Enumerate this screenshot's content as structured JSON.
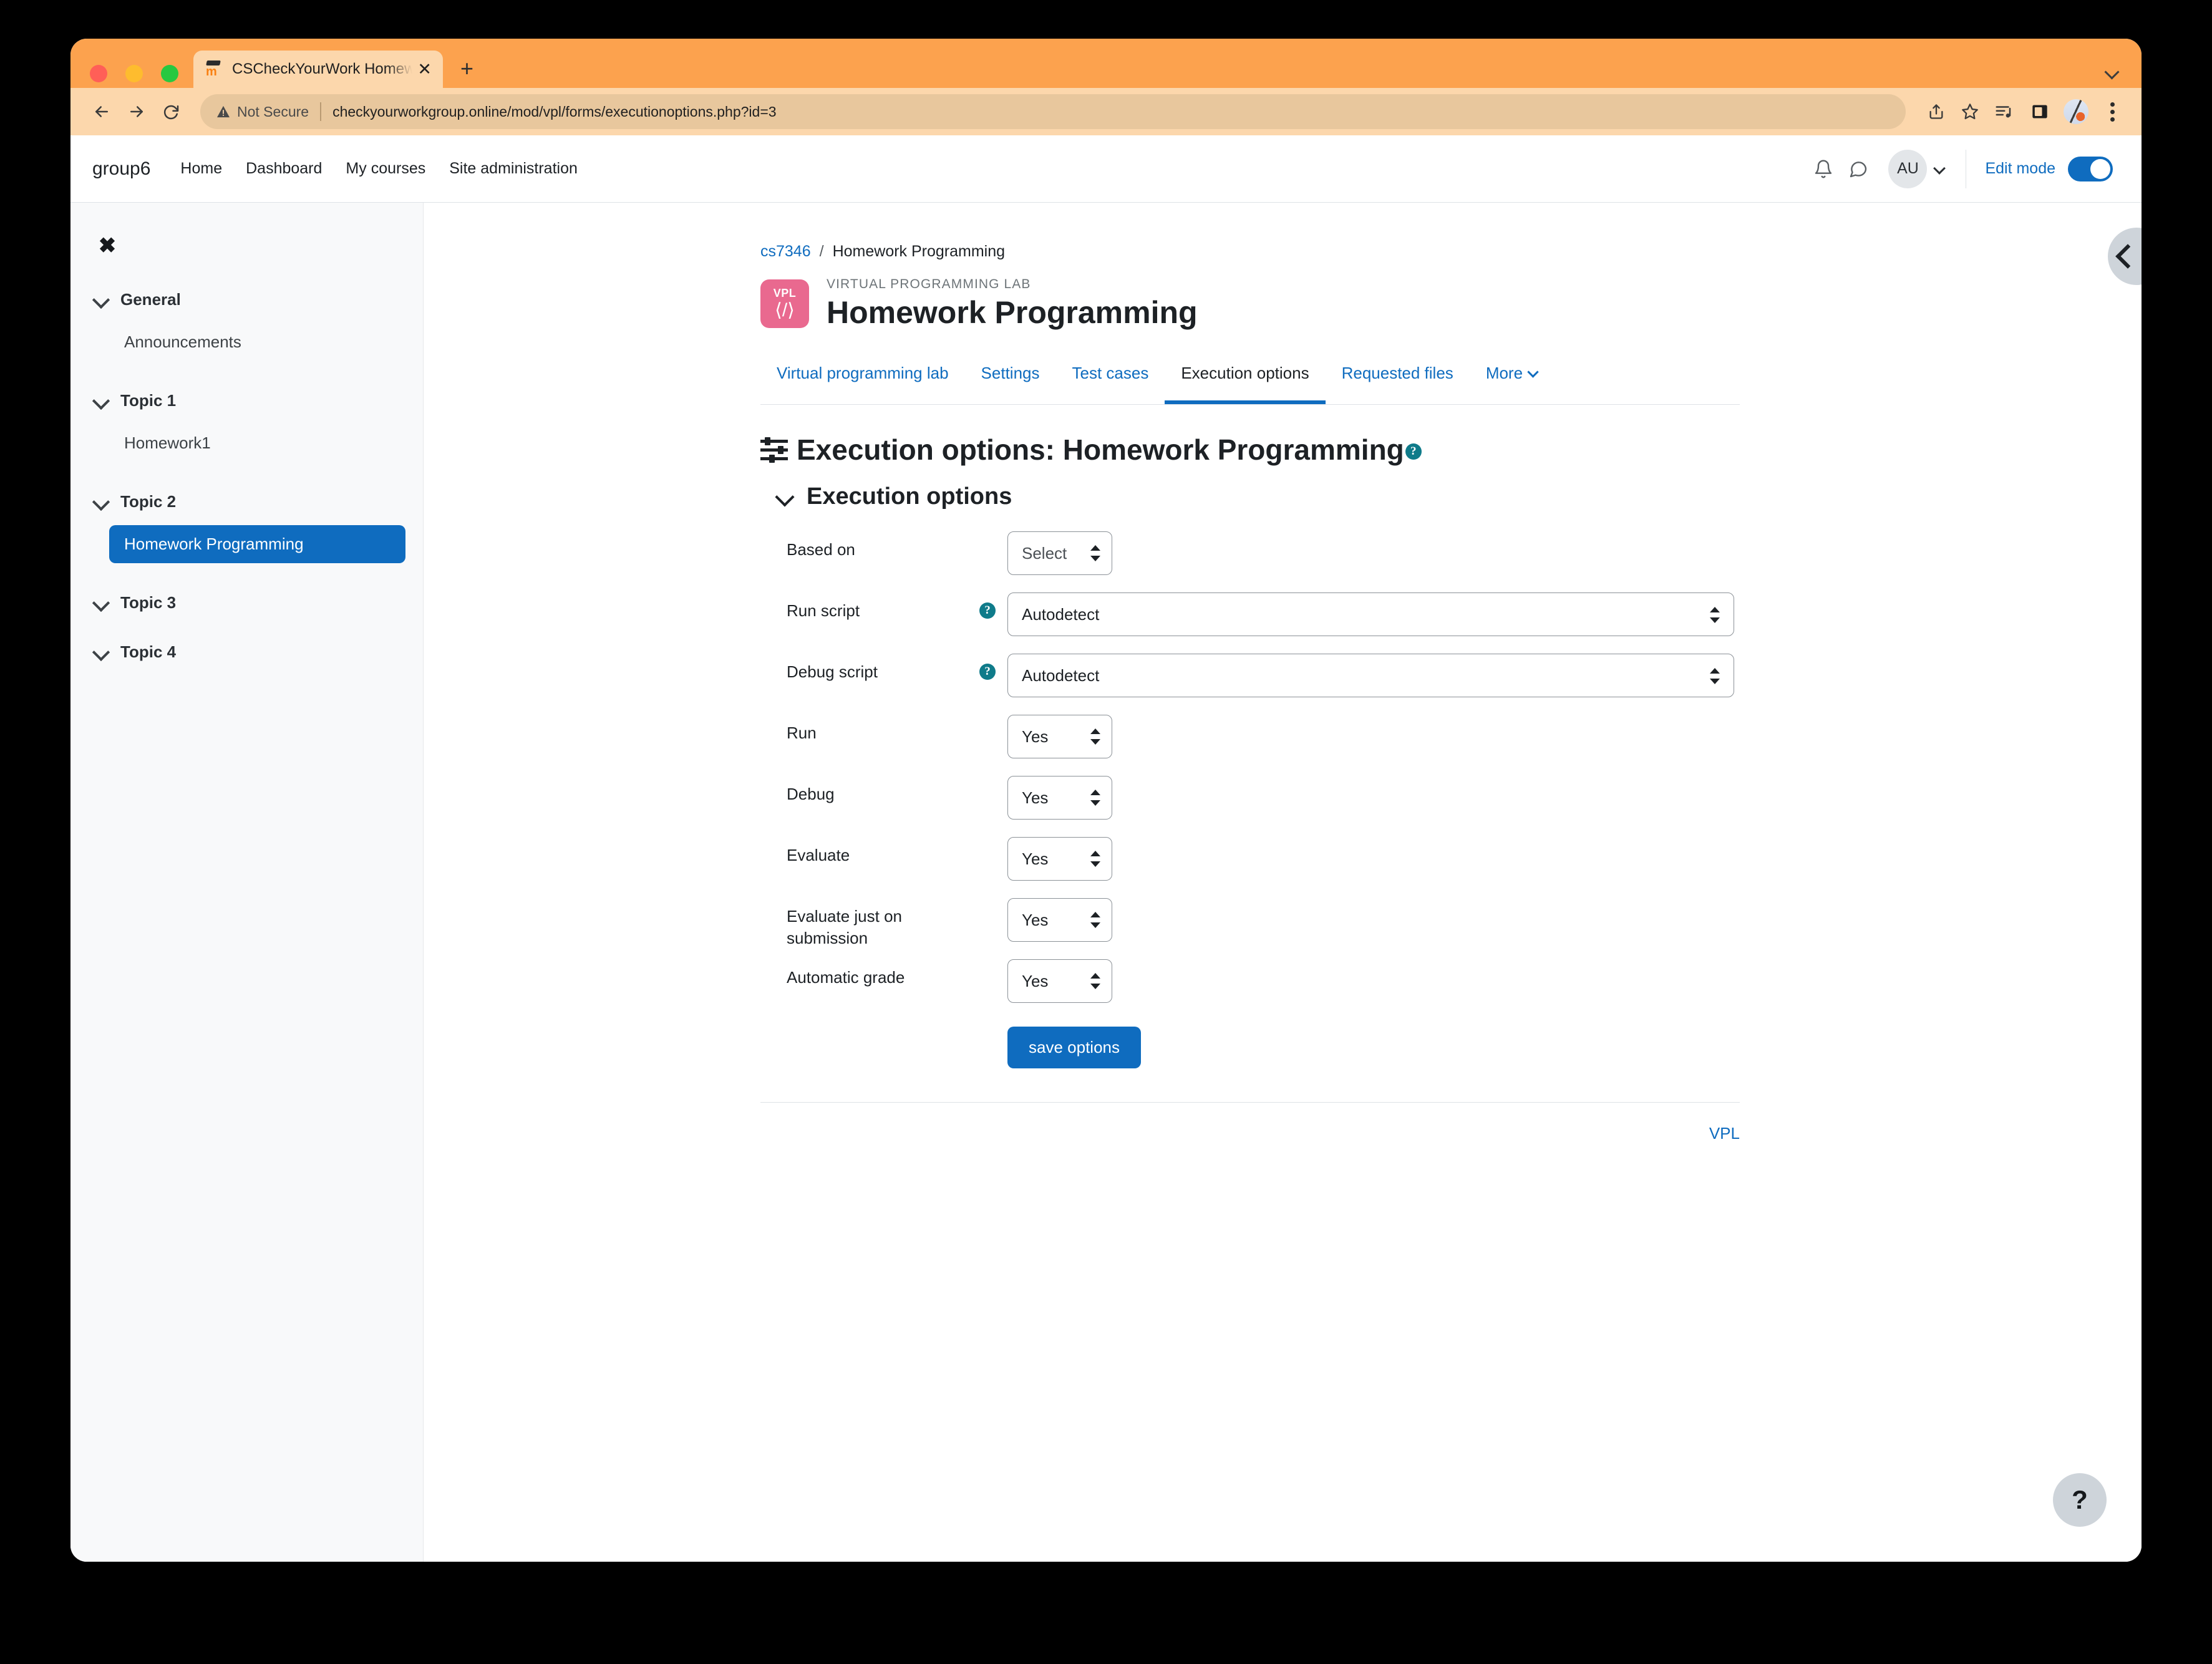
{
  "browser": {
    "tab": {
      "title": "CSCheckYourWork Homework",
      "favicon": "moodle-icon",
      "close_label": "✕"
    },
    "new_tab_label": "+",
    "omnibox": {
      "security_label": "Not Secure",
      "url": "checkyourworkgroup.online/mod/vpl/forms/executionoptions.php?id=3"
    },
    "toolbar_icons": [
      "share-icon",
      "bookmark-star-icon",
      "media-playlist-icon",
      "side-panel-icon",
      "profile-avatar",
      "three-dot-menu-icon"
    ]
  },
  "navbar": {
    "brand": "group6",
    "links": [
      "Home",
      "Dashboard",
      "My courses",
      "Site administration"
    ],
    "notification_icon": "bell-icon",
    "message_icon": "speech-bubble-icon",
    "avatar_initials": "AU",
    "edit_mode_label": "Edit mode",
    "edit_mode_on": true
  },
  "sidebar": {
    "close_label": "✖",
    "sections": [
      {
        "title": "General",
        "items": [
          "Announcements"
        ]
      },
      {
        "title": "Topic 1",
        "items": [
          "Homework1"
        ]
      },
      {
        "title": "Topic 2",
        "items": [
          "Homework Programming"
        ]
      },
      {
        "title": "Topic 3",
        "items": []
      },
      {
        "title": "Topic 4",
        "items": []
      }
    ],
    "active_item": "Homework Programming"
  },
  "breadcrumb": {
    "course": "cs7346",
    "separator": "/",
    "current": "Homework Programming"
  },
  "activity": {
    "icon_label": "VPL",
    "icon_glyph": "⟨/⟩",
    "type_label": "VIRTUAL PROGRAMMING LAB",
    "title": "Homework Programming",
    "icon_color": "#e9698f"
  },
  "tabs": [
    {
      "label": "Virtual programming lab",
      "active": false,
      "caret": false
    },
    {
      "label": "Settings",
      "active": false,
      "caret": false
    },
    {
      "label": "Test cases",
      "active": false,
      "caret": false
    },
    {
      "label": "Execution options",
      "active": true,
      "caret": false
    },
    {
      "label": "Requested files",
      "active": false,
      "caret": false
    },
    {
      "label": "More",
      "active": false,
      "caret": true
    }
  ],
  "page": {
    "heading": "Execution options: Homework Programming",
    "heading_help": "?",
    "section_title": "Execution options"
  },
  "form": {
    "fields": [
      {
        "label": "Based on",
        "value": "Select",
        "width": "narrow",
        "help": false,
        "placeholder": true
      },
      {
        "label": "Run script",
        "value": "Autodetect",
        "width": "wide",
        "help": true,
        "placeholder": false
      },
      {
        "label": "Debug script",
        "value": "Autodetect",
        "width": "wide",
        "help": true,
        "placeholder": false
      },
      {
        "label": "Run",
        "value": "Yes",
        "width": "narrow",
        "help": false,
        "placeholder": false
      },
      {
        "label": "Debug",
        "value": "Yes",
        "width": "narrow",
        "help": false,
        "placeholder": false
      },
      {
        "label": "Evaluate",
        "value": "Yes",
        "width": "narrow",
        "help": false,
        "placeholder": false
      },
      {
        "label": "Evaluate just on submission",
        "value": "Yes",
        "width": "narrow",
        "help": false,
        "placeholder": false
      },
      {
        "label": "Automatic grade",
        "value": "Yes",
        "width": "narrow",
        "help": false,
        "placeholder": false
      }
    ],
    "save_label": "save options",
    "help_symbol": "?"
  },
  "footer": {
    "vpl_link": "VPL"
  },
  "help_fab_label": "?",
  "colors": {
    "accent_blue": "#0f6cbf",
    "browser_chrome": "#fca24e",
    "browser_toolbar": "#fcd7ac",
    "sidebar_bg": "#f8f9fa",
    "help_teal": "#0f7b8a",
    "vpl_pink": "#e9698f"
  }
}
